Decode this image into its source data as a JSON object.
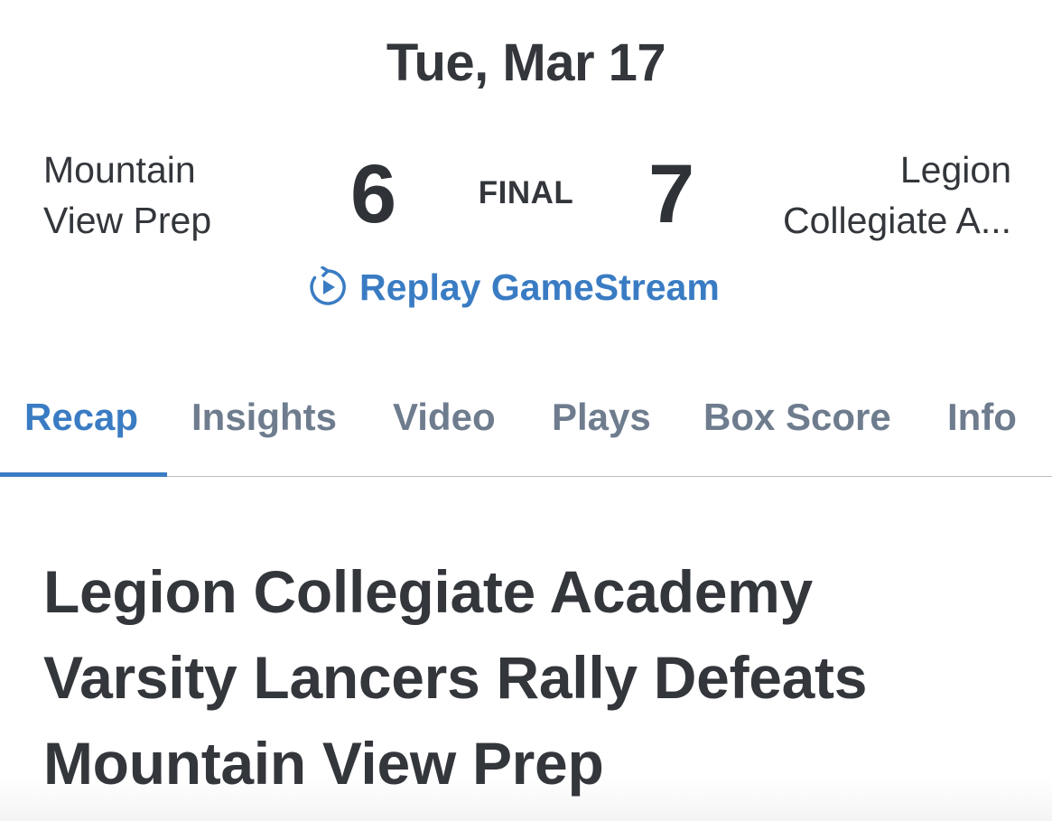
{
  "header": {
    "date": "Tue, Mar 17"
  },
  "game": {
    "home_team_line1": "Mountain",
    "home_team_line2": "View Prep",
    "home_score": "6",
    "status": "FINAL",
    "away_score": "7",
    "away_team_line1": "Legion",
    "away_team_line2": "Collegiate A...",
    "replay_label": "Replay GameStream",
    "replay_icon": "replay-play-icon",
    "accent_color": "#3a7cc3"
  },
  "tabs": [
    {
      "label": "Recap",
      "active": true
    },
    {
      "label": "Insights",
      "active": false
    },
    {
      "label": "Video",
      "active": false
    },
    {
      "label": "Plays",
      "active": false
    },
    {
      "label": "Box Score",
      "active": false
    },
    {
      "label": "Info",
      "active": false
    }
  ],
  "article": {
    "headline_line1": "Legion Collegiate Academy",
    "headline_line2": "Varsity Lancers Rally Defeats",
    "headline_line3": "Mountain View Prep"
  }
}
